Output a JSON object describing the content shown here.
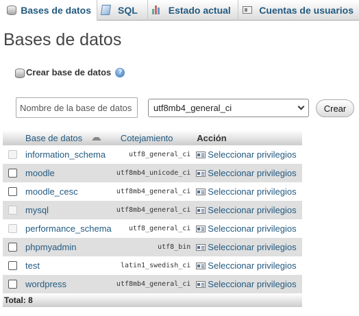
{
  "tabs": [
    {
      "label": "Bases de datos",
      "icon": "database-icon",
      "active": true
    },
    {
      "label": "SQL",
      "icon": "sql-icon",
      "active": false
    },
    {
      "label": "Estado actual",
      "icon": "status-chart-icon",
      "active": false
    },
    {
      "label": "Cuentas de usuarios",
      "icon": "user-accounts-icon",
      "active": false
    }
  ],
  "page": {
    "title": "Bases de datos"
  },
  "create": {
    "label": "Crear base de datos",
    "name_placeholder": "Nombre de la base de datos",
    "collation_value": "utf8mb4_general_ci",
    "button": "Crear"
  },
  "table": {
    "headers": {
      "name": "Base de datos",
      "collation": "Cotejamiento",
      "action": "Acción"
    },
    "action_label": "Seleccionar privilegios",
    "rows": [
      {
        "name": "information_schema",
        "collation": "utf8_general_ci",
        "selectable": false
      },
      {
        "name": "moodle",
        "collation": "utf8mb4_unicode_ci",
        "selectable": true
      },
      {
        "name": "moodle_cesc",
        "collation": "utf8mb4_general_ci",
        "selectable": true
      },
      {
        "name": "mysql",
        "collation": "utf8mb4_general_ci",
        "selectable": false
      },
      {
        "name": "performance_schema",
        "collation": "utf8_general_ci",
        "selectable": false
      },
      {
        "name": "phpmyadmin",
        "collation": "utf8_bin",
        "selectable": true
      },
      {
        "name": "test",
        "collation": "latin1_swedish_ci",
        "selectable": true
      },
      {
        "name": "wordpress",
        "collation": "utf8mb4_general_ci",
        "selectable": true
      }
    ],
    "total": "Total: 8"
  },
  "colors": {
    "link": "#235a81",
    "row_alt": "#dfdfdf",
    "header_gradient_end": "#cccccc"
  }
}
